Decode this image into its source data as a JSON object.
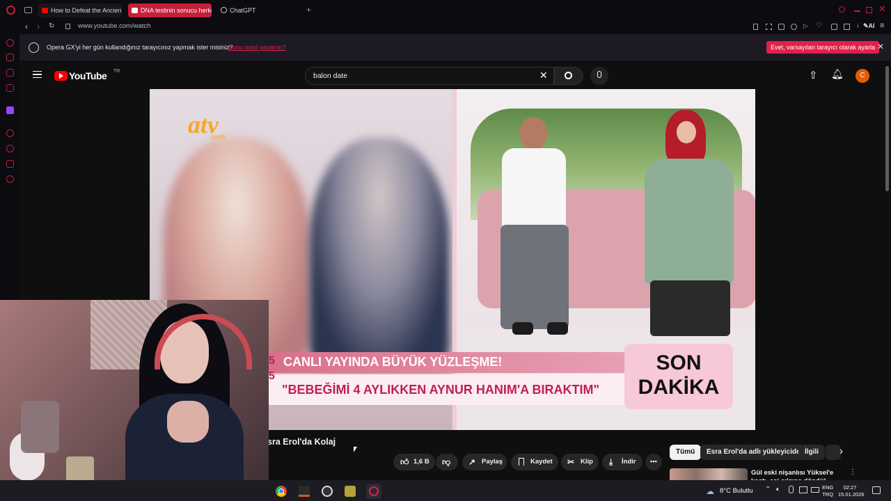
{
  "browser": {
    "tabs": [
      {
        "label": "How to Defeat the Ancient",
        "active": false
      },
      {
        "label": "DNA testinin sonucu herkes",
        "active": true
      },
      {
        "label": "ChatGPT",
        "active": false
      }
    ],
    "url": "www.youtube.com/watch",
    "ai_label": "AI",
    "banner": {
      "message": "Opera GX'yi her gün kullandığınız tarayıcınız yapmak ister misiniz?",
      "link": "Bunu nasıl yaparım?",
      "button": "Evet, varsayılan tarayıcı olarak ayarla"
    }
  },
  "youtube": {
    "logo_text": "YouTube",
    "country": "TR",
    "search_value": "balon date",
    "avatar_letter": "C",
    "video": {
      "title": "sra Erol'da Kolaj",
      "overlay_brand": "atv",
      "overlay_live": "canlı",
      "banner_top": "CANLI YAYINDA BÜYÜK YÜZLEŞME!",
      "banner_quote": "\"BEBEĞİMİ 4 AYLIKKEN AYNUR HANIM'A BIRAKTIM\"",
      "badge_line1": "SON",
      "badge_line2": "DAKİKA",
      "side_numbers": "5\n5"
    },
    "actions": {
      "likes": "1,6 B",
      "share": "Paylaş",
      "save": "Kaydet",
      "clip": "Klip",
      "download": "İndir"
    },
    "chips": [
      "Tümü",
      "Esra Erol'da adlı yükleyiciden",
      "İlgili"
    ],
    "recommendation": {
      "title": "Gül eski nişanlısı Yüksel'e kaçtı, eşi çılgına döndü! - Esra Erol'd"
    }
  },
  "taskbar": {
    "weather": "8°C Bulutlu",
    "lang_line1": "ENG",
    "lang_line2": "TRQ",
    "time": "02:27",
    "date": "15.01.2026"
  },
  "colors": {
    "opera_red": "#c4203a",
    "yt_red": "#ff0000",
    "banner_button": "#e3204a",
    "avatar": "#e65c00"
  }
}
